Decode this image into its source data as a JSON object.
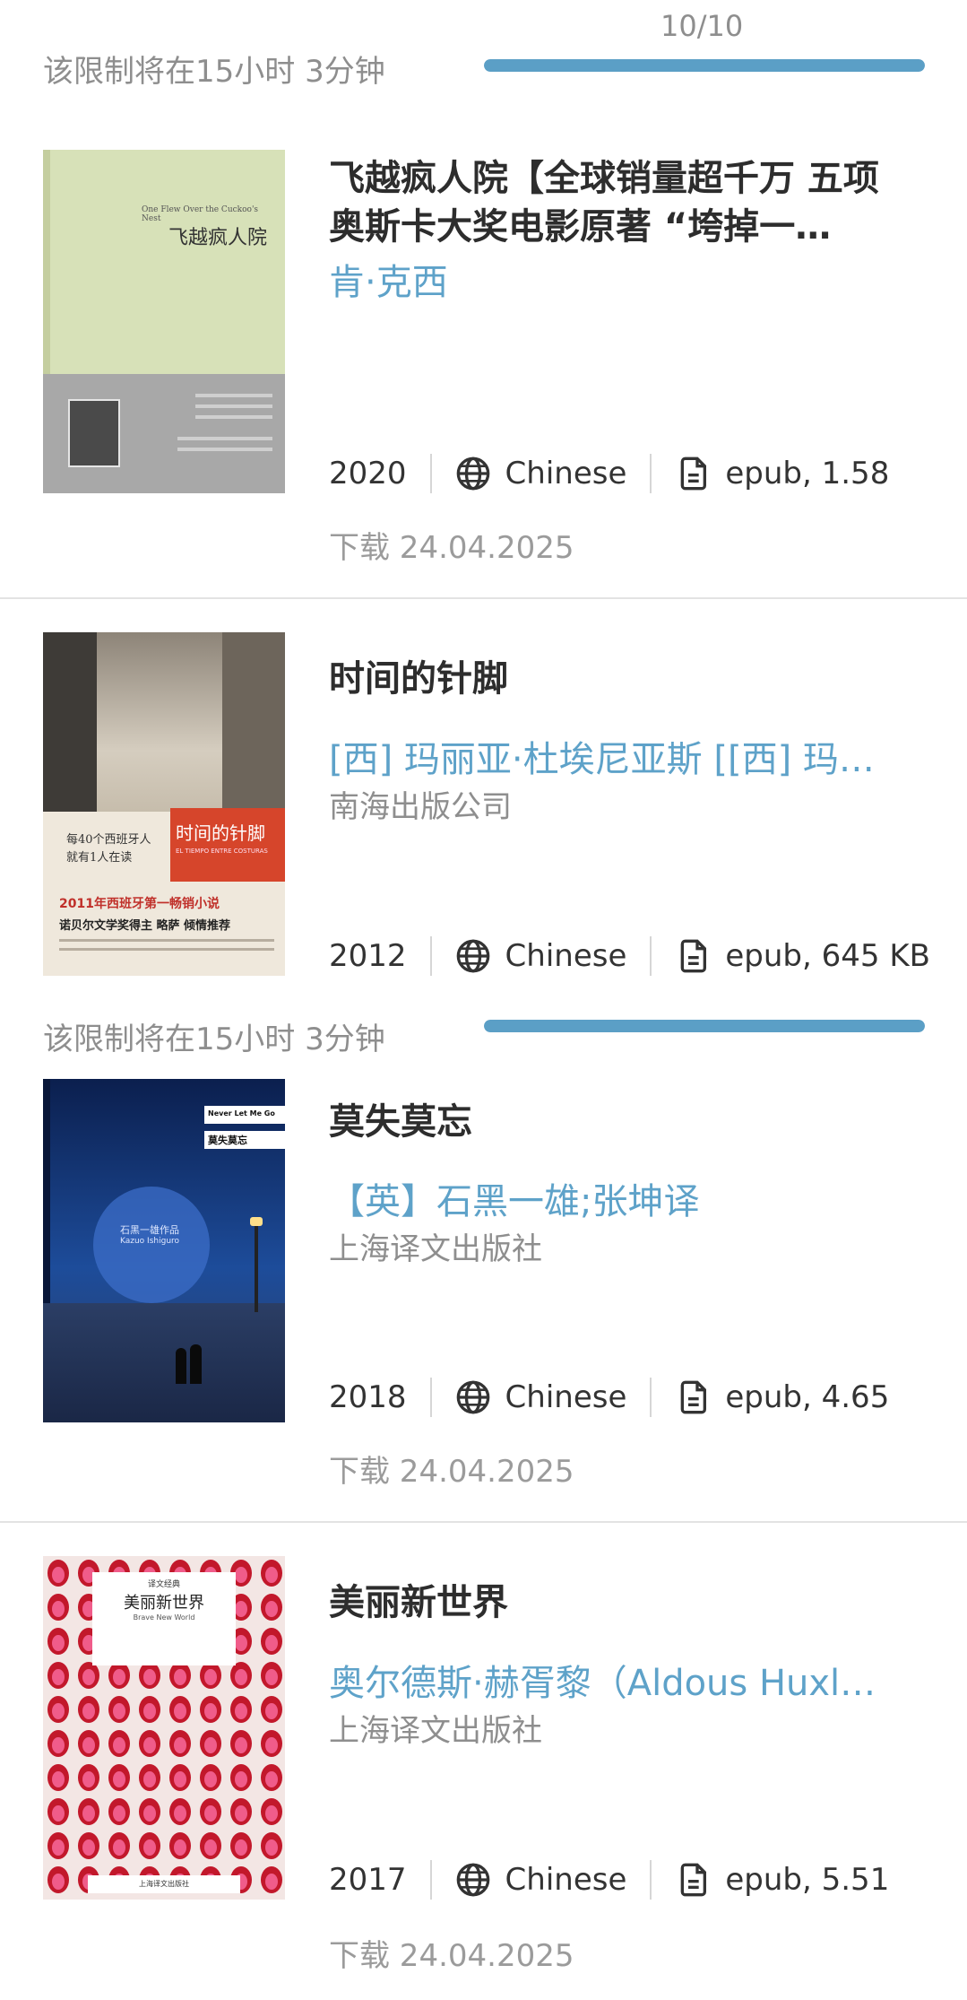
{
  "limit_banner": {
    "text": "该限制将在15小时 3分钟",
    "count": "10/10",
    "progress": 1.0
  },
  "books": [
    {
      "title": "飞越疯人院【全球销量超千万 五项奥斯卡大奖电影原著 “垮掉一…",
      "author": "肯·克西",
      "publisher": "",
      "year": "2020",
      "language": "Chinese",
      "format": "epub, 1.58",
      "downloaded": "下载 24.04.2025",
      "cover": {
        "title_en": "One Flew Over the Cuckoo's Nest",
        "title_cn": "飞越疯人院",
        "colors": [
          "#d7e1b8",
          "#a7a7a7"
        ]
      }
    },
    {
      "title": "时间的针脚",
      "author": "[西] 玛丽亚·杜埃尼亚斯 [[西] 玛…",
      "publisher": "南海出版公司",
      "year": "2012",
      "language": "Chinese",
      "format": "epub, 645 KB",
      "downloaded": "",
      "cover": {
        "title_cn": "时间的针脚",
        "subtitle": "EL TIEMPO ENTRE COSTURAS",
        "tagline": "每40个西班牙人 就有1人在读",
        "promo": "2011年西班牙第一畅销小说",
        "promo2": "诺贝尔文学奖得主 略萨 倾情推荐"
      }
    },
    {
      "title": "莫失莫忘",
      "author": "【英】石黑一雄;张坤译",
      "publisher": "上海译文出版社",
      "year": "2018",
      "language": "Chinese",
      "format": "epub, 4.65",
      "downloaded": "下载 24.04.2025",
      "cover": {
        "title_en": "Never Let Me Go",
        "title_cn": "莫失莫忘",
        "author_en": "Kazuo Ishiguro",
        "author_cn": "石黑一雄作品"
      }
    },
    {
      "title": "美丽新世界",
      "author": "奥尔德斯·赫胥黎（Aldous Huxl…",
      "publisher": "上海译文出版社",
      "year": "2017",
      "language": "Chinese",
      "format": "epub, 5.51",
      "downloaded": "下载 24.04.2025",
      "cover": {
        "series": "译文经典",
        "title_cn": "美丽新世界",
        "title_en": "Brave New World",
        "publisher": "上海译文出版社"
      }
    }
  ]
}
